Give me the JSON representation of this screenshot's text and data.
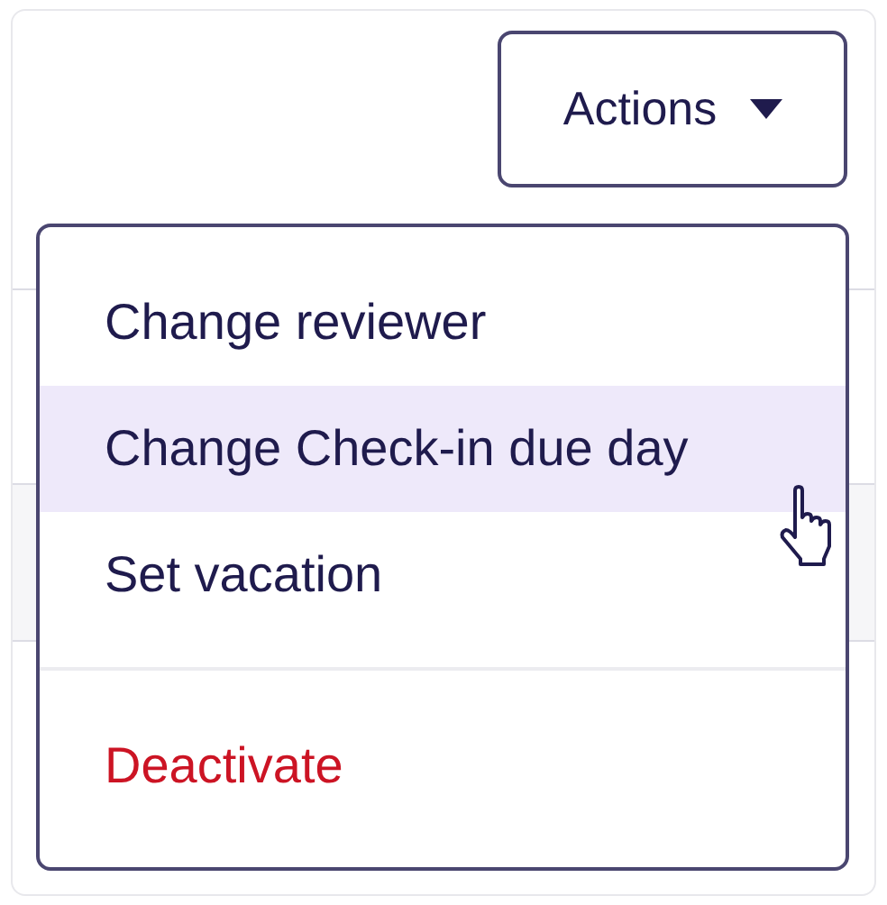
{
  "actions_button": {
    "label": "Actions",
    "expanded": true
  },
  "menu": {
    "groups": [
      [
        {
          "label": "Change reviewer",
          "kind": "normal",
          "selected": false
        },
        {
          "label": "Change Check-in due day",
          "kind": "normal",
          "selected": true
        },
        {
          "label": "Set vacation",
          "kind": "normal",
          "selected": false
        }
      ],
      [
        {
          "label": "Deactivate",
          "kind": "danger",
          "selected": false
        }
      ]
    ]
  }
}
